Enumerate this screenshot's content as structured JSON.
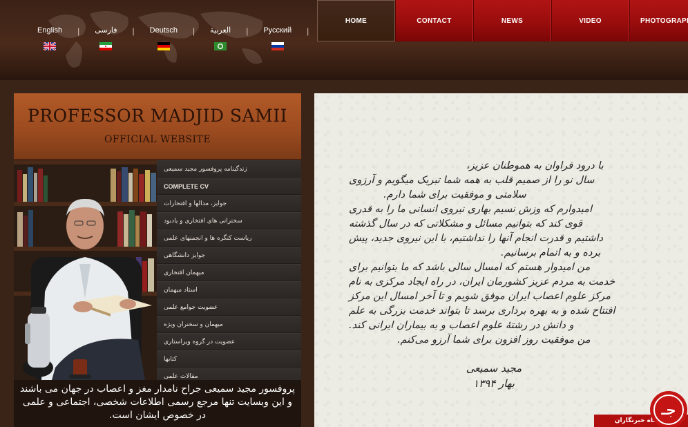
{
  "languages": [
    {
      "label": "English",
      "flag": "uk"
    },
    {
      "label": "فارسی",
      "flag": "iran"
    },
    {
      "label": "Deutsch",
      "flag": "germany"
    },
    {
      "label": "العربية",
      "flag": "saudi"
    },
    {
      "label": "Русский",
      "flag": "russia"
    }
  ],
  "lang_separator": "|",
  "nav": [
    {
      "label": "HOME",
      "active": true
    },
    {
      "label": "CONTACT"
    },
    {
      "label": "NEWS"
    },
    {
      "label": "VIDEO"
    },
    {
      "label": "PHOTOGRAPH"
    }
  ],
  "banner": {
    "title": "PROFESSOR MADJID SAMII",
    "subtitle": "OFFICIAL WEBSITE"
  },
  "menu": [
    "زندگینامه پروفسور مجید سمیعی",
    "COMPLETE CV",
    "جوایز، مدالها و افتخارات",
    "سخنرانی های افتخاری و یادبود",
    "ریاست کنگره ها و انجمنهای علمی",
    "جوایز دانشگاهی",
    "میهمان افتخاری",
    "استاد میهمان",
    "عضویت جوامع علمی",
    "میهمان و سخنران ویژه",
    "عضویت در گروه ویراستاری",
    "کتابها",
    "مقالات علمی"
  ],
  "bio": "پروفسور مجید سمیعی جراح نامدار مغز و اعصاب در جهان می باشند و این وبسایت تنها مرجع رسمی اطلاعات شخصی، اجتماعی و علمی در خصوص ایشان است.",
  "message_lines": [
    "با درود فراوان به هموطنان عزیز،",
    "سال نو را از صمیم قلب به همه شما تبریک میگویم و آرزوی",
    "سلامتی و موفقیت برای شما دارم.",
    "امیدوارم که وزش نسیم بهاری نیروی انسانی ما را به قدری",
    "قوی کند که بتوانیم مسائل و مشکلاتی که در سال گذشته",
    "داشتیم و قدرت انجام آنها را نداشتیم، با این نیروی جدید، پیش",
    "برده و به اتمام برسانیم.",
    "من امیدوار هستم که امسال سالی باشد که ما بتوانیم برای",
    "خدمت به مردم عزیز کشورمان ایران، در راه ایجاد مرکزی به نام",
    "مرکز علوم اعصاب ایران موفق شویم و تا آخر امسال این مرکز",
    "افتتاح شده و به بهره برداری برسد تا بتواند خدمت بزرگی به علم",
    "و دانش در رشتهٔ علوم اعصاب و به بیماران ایرانی کند.",
    "من موفقیت روز افزون برای شما آرزو می‌کنم."
  ],
  "signature": {
    "name": "مجید سمیعی",
    "date": "بهار ۱۳۹۴"
  },
  "watermark": {
    "label": "باشگاه خبرنگاران",
    "logo_text": "جـ"
  }
}
